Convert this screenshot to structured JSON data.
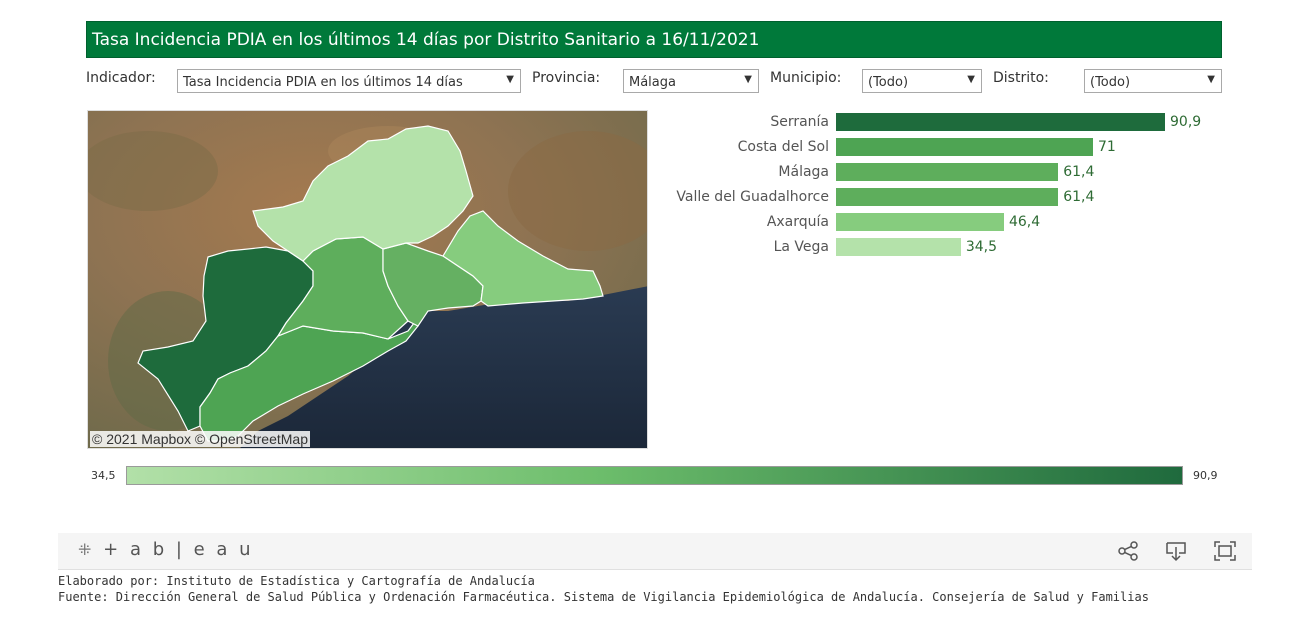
{
  "header": {
    "title": "Tasa Incidencia PDIA en los últimos 14 días por Distrito Sanitario a 16/11/2021"
  },
  "filters": {
    "indicador": {
      "label": "Indicador:",
      "value": "Tasa Incidencia PDIA en los últimos 14 días"
    },
    "provincia": {
      "label": "Provincia:",
      "value": "Málaga"
    },
    "municipio": {
      "label": "Municipio:",
      "value": "(Todo)"
    },
    "distrito": {
      "label": "Distrito:",
      "value": "(Todo)"
    }
  },
  "map": {
    "attribution": "© 2021 Mapbox  © OpenStreetMap"
  },
  "chart_data": {
    "type": "bar",
    "orientation": "horizontal",
    "categories": [
      "Serranía",
      "Costa del Sol",
      "Málaga",
      "Valle del Guadalhorce",
      "Axarquía",
      "La Vega"
    ],
    "values": [
      90.9,
      71,
      61.4,
      61.4,
      46.4,
      34.5
    ],
    "value_labels": [
      "90,9",
      "71",
      "61,4",
      "61,4",
      "46,4",
      "34,5"
    ],
    "colors": [
      "#1e6b3c",
      "#4ea453",
      "#5eae5c",
      "#5eae5c",
      "#86cc7e",
      "#b4e2aa"
    ]
  },
  "legend": {
    "min": "34,5",
    "max": "90,9"
  },
  "toolbar": {
    "logo": "+ a b | e a u"
  },
  "footer": {
    "line1": "Elaborado por: Instituto de Estadística y Cartografía de Andalucía",
    "line2": "Fuente: Dirección General de Salud Pública y Ordenación Farmacéutica. Sistema de Vigilancia Epidemiológica de Andalucía. Consejería de Salud y Familias"
  }
}
